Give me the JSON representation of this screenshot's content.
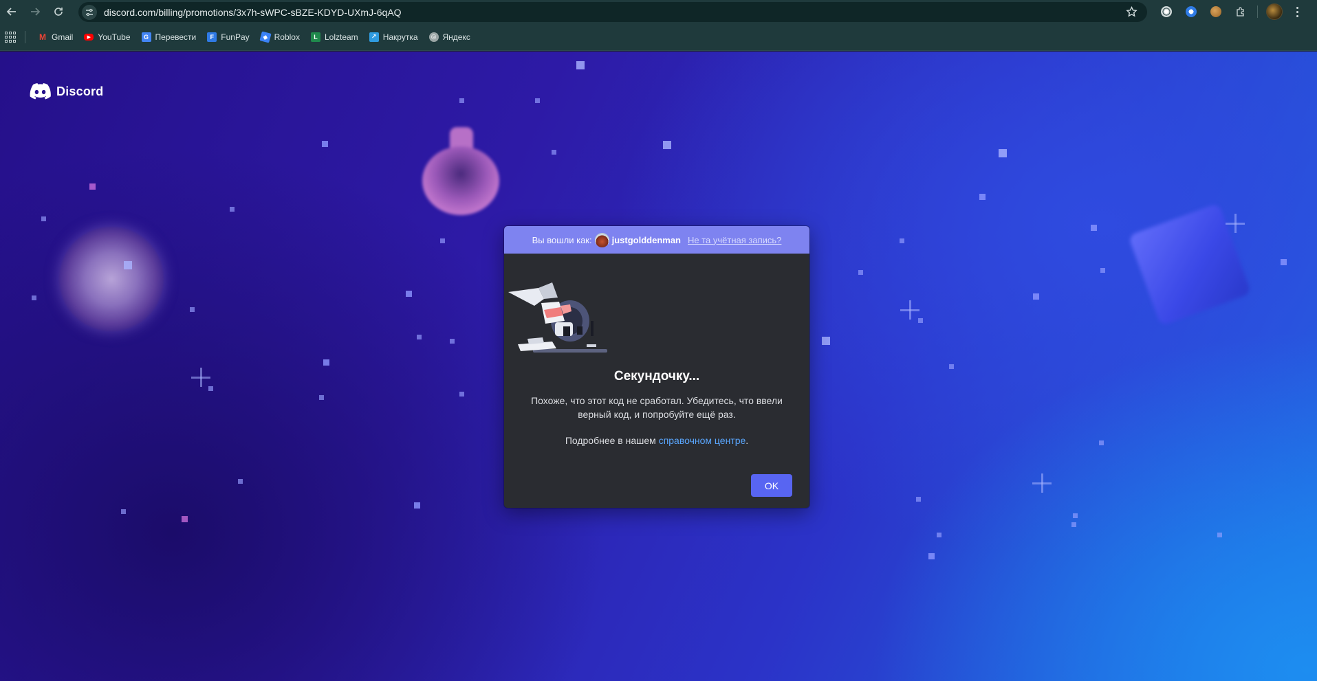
{
  "browser": {
    "url": "discord.com/billing/promotions/3x7h-sWPC-sBZE-KDYD-UXmJ-6qAQ",
    "bookmarks": [
      {
        "label": "Gmail",
        "icon": "gmail-icon",
        "color": "#ea4335"
      },
      {
        "label": "YouTube",
        "icon": "youtube-icon",
        "color": "#ff0000"
      },
      {
        "label": "Перевести",
        "icon": "google-translate-icon",
        "color": "#4285f4"
      },
      {
        "label": "FunPay",
        "icon": "funpay-icon",
        "color": "#2f7ae5"
      },
      {
        "label": "Roblox",
        "icon": "roblox-icon",
        "color": "#3b82f6"
      },
      {
        "label": "Lolzteam",
        "icon": "lolzteam-icon",
        "color": "#1f8a4c"
      },
      {
        "label": "Накрутка",
        "icon": "nakrutka-icon",
        "color": "#2f9be0"
      },
      {
        "label": "Яндекс",
        "icon": "globe-icon",
        "color": "#9aa5a5"
      }
    ]
  },
  "page": {
    "brand": "Discord",
    "modal": {
      "logged_in_prefix": "Вы вошли как:",
      "username": "justgolddenman",
      "wrong_account": "Не та учётная запись?",
      "title": "Секундочку...",
      "message": "Похоже, что этот код не сработал. Убедитесь, что ввели верный код, и попробуйте ещё раз.",
      "help_prefix": "Подробнее в нашем",
      "help_link": "справочном центре",
      "help_suffix": ".",
      "ok_label": "OK"
    }
  },
  "colors": {
    "accent": "#5865f2",
    "auth_bar": "#7e83f0",
    "link": "#5aa7ff"
  }
}
